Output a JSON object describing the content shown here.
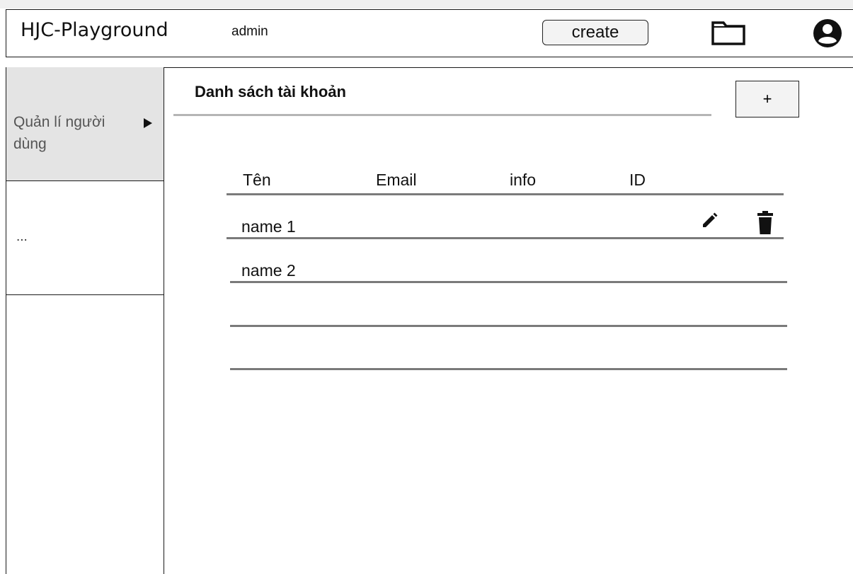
{
  "header": {
    "app_title": "HJC-Playground",
    "user": "admin",
    "create_label": "create",
    "icons": [
      "folder-icon",
      "account-circle-icon"
    ]
  },
  "sidebar": {
    "items": [
      {
        "label": "Quản lí người dùng",
        "active": true,
        "icon": "chevron-right-icon"
      },
      {
        "label": "..."
      }
    ]
  },
  "main": {
    "title": "Danh sách tài khoản",
    "add_label": "+",
    "table": {
      "columns": [
        "Tên",
        "Email",
        "info",
        "ID"
      ],
      "rows": [
        {
          "name": "name 1",
          "actions": [
            "edit-icon",
            "delete-icon"
          ]
        },
        {
          "name": "name 2"
        }
      ]
    }
  },
  "colors": {
    "active_item_bg": "#e4e4e4",
    "border": "#1a1a1a",
    "section_line": "#b5b5b5",
    "row_line": "#7a7a7a"
  }
}
